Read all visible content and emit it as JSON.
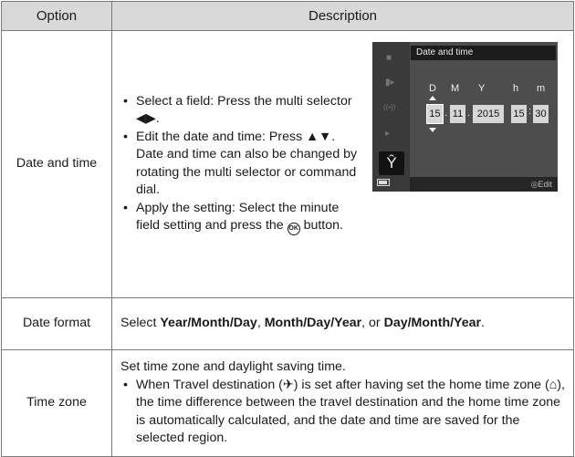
{
  "table": {
    "header": {
      "option": "Option",
      "description": "Description"
    },
    "rows": [
      {
        "option": "Date and time",
        "bullets": [
          {
            "text": "Select a field: Press the multi selector ◀▶."
          },
          {
            "text": "Edit the date and time: Press ▲▼. Date and time can also be changed by rotating the multi selector or command dial."
          },
          {
            "text_before": "Apply the setting: Select the minute field setting and press the ",
            "icon": "OK",
            "text_after": " button."
          }
        ]
      },
      {
        "option": "Date format",
        "parts": [
          "Select ",
          "Year/Month/Day",
          ", ",
          "Month/Day/Year",
          ", or ",
          "Day/Month/Year",
          "."
        ]
      },
      {
        "option": "Time zone",
        "intro": "Set time zone and daylight saving time.",
        "bullet": {
          "p1": "When Travel destination (",
          "icon1": "✈",
          "p2": ") is set after having set the home time zone (",
          "icon2": "⌂",
          "p3": "), the time difference between the travel destination and the home time zone is automatically calculated, and the date and time are saved for the selected region."
        }
      }
    ]
  },
  "camera_screen": {
    "title": "Date and time",
    "labels": [
      "D",
      "M",
      "Y",
      "h",
      "m"
    ],
    "values": {
      "day": "15",
      "month": "11",
      "year": "2015",
      "hour": "15",
      "minute": "30"
    },
    "edit_label": "Edit",
    "edit_icon": "multi-selector-icon",
    "menu_icons": [
      "camera-icon",
      "movie-icon",
      "wifi-icon",
      "playback-icon",
      "wrench-icon"
    ],
    "accent_color": "#121212"
  }
}
